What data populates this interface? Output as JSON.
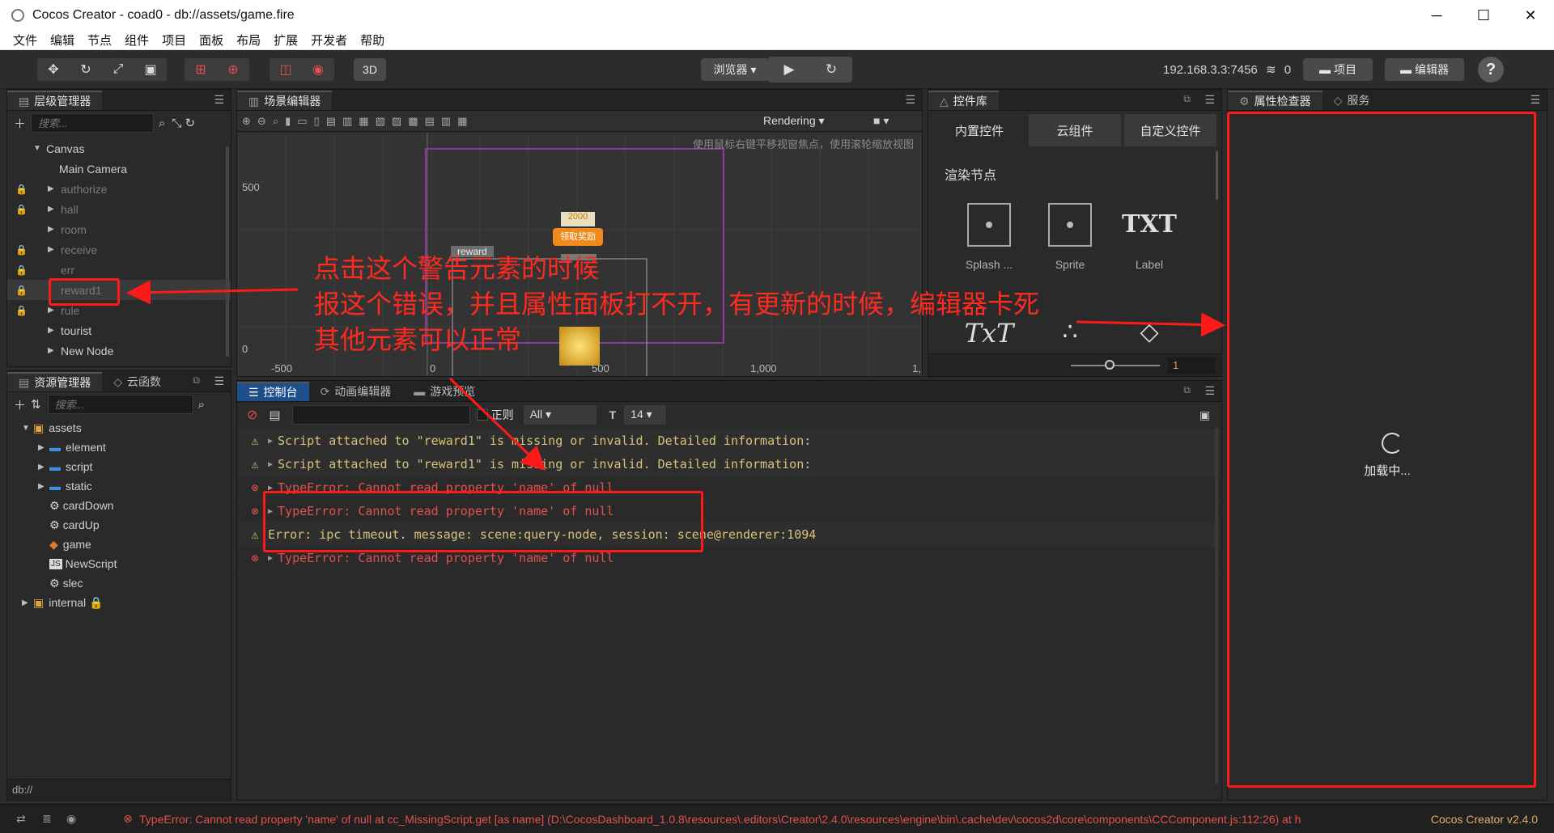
{
  "window": {
    "title": "Cocos Creator - coad0 - db://assets/game.fire",
    "minimize": "─",
    "maximize": "☐",
    "close": "✕"
  },
  "menu": [
    "文件",
    "编辑",
    "节点",
    "组件",
    "项目",
    "面板",
    "布局",
    "扩展",
    "开发者",
    "帮助"
  ],
  "toolbar": {
    "transform_icons": [
      "✥",
      "↻",
      "⤢",
      "▣"
    ],
    "pivot_icons": [
      "⊞",
      "⊕"
    ],
    "gizmo_icons": [
      "◫",
      "◉"
    ],
    "mode_3d": "3D",
    "browser_label": "浏览器 ▾",
    "play_icon": "▶",
    "refresh_icon": "↻",
    "ip": "192.168.3.3:7456",
    "wifi_icon": "≋",
    "connections": "0",
    "project_button": "项目",
    "editor_button": "编辑器",
    "help": "?"
  },
  "hierarchy": {
    "title": "层级管理器",
    "search_placeholder": "搜索...",
    "items": [
      {
        "label": "Canvas",
        "arrow": "▼",
        "locked": false,
        "dim": false
      },
      {
        "label": "Main Camera",
        "arrow": "",
        "locked": false,
        "dim": false
      },
      {
        "label": "authorize",
        "arrow": "▶",
        "locked": true,
        "dim": true
      },
      {
        "label": "hall",
        "arrow": "▶",
        "locked": true,
        "dim": true
      },
      {
        "label": "room",
        "arrow": "▶",
        "locked": false,
        "dim": true
      },
      {
        "label": "receive",
        "arrow": "▶",
        "locked": true,
        "dim": true
      },
      {
        "label": "err",
        "arrow": "",
        "locked": true,
        "dim": true
      },
      {
        "label": "reward1",
        "arrow": "",
        "locked": true,
        "dim": true
      },
      {
        "label": "rule",
        "arrow": "▶",
        "locked": true,
        "dim": true
      },
      {
        "label": "tourist",
        "arrow": "▶",
        "locked": false,
        "dim": false
      },
      {
        "label": "New Node",
        "arrow": "▶",
        "locked": false,
        "dim": false
      }
    ]
  },
  "assets": {
    "tab_assets": "资源管理器",
    "tab_cloud": "云函数",
    "search_placeholder": "搜索...",
    "items": [
      {
        "label": "assets",
        "icon": "▣",
        "indent": 0,
        "arrow": "▼"
      },
      {
        "label": "element",
        "icon": "▬",
        "indent": 1,
        "arrow": "▶"
      },
      {
        "label": "script",
        "icon": "▬",
        "indent": 1,
        "arrow": "▶"
      },
      {
        "label": "static",
        "icon": "▬",
        "indent": 1,
        "arrow": "▶"
      },
      {
        "label": "cardDown",
        "icon": "⚙",
        "indent": 1,
        "arrow": ""
      },
      {
        "label": "cardUp",
        "icon": "⚙",
        "indent": 1,
        "arrow": ""
      },
      {
        "label": "game",
        "icon": "◆",
        "indent": 1,
        "arrow": ""
      },
      {
        "label": "NewScript",
        "icon": "JS",
        "indent": 1,
        "arrow": ""
      },
      {
        "label": "slec",
        "icon": "⚙",
        "indent": 1,
        "arrow": ""
      },
      {
        "label": "internal 🔒",
        "icon": "▣",
        "indent": 0,
        "arrow": "▶"
      }
    ],
    "path": "db://"
  },
  "scene": {
    "title": "场景编辑器",
    "rendering": "Rendering",
    "hint": "使用鼠标右键平移视窗焦点，使用滚轮缩放视图",
    "axis_y_500": "500",
    "axis_y_0": "0",
    "axis_x": [
      "-500",
      "0",
      "500",
      "1,000",
      "1,"
    ],
    "reward_label": "reward",
    "gold_text": "2000",
    "button_text": "领取奖励"
  },
  "library": {
    "title": "控件库",
    "tabs": [
      "内置控件",
      "云组件",
      "自定义控件"
    ],
    "section": "渲染节点",
    "items": [
      {
        "label": "Splash ...",
        "kind": "icon"
      },
      {
        "label": "Sprite",
        "kind": "icon"
      },
      {
        "label": "Label",
        "kind": "TXT"
      }
    ],
    "row2": [
      "TxT",
      "∴",
      "◇"
    ],
    "slider_value": "1"
  },
  "inspector": {
    "tab_inspector": "属性检查器",
    "tab_service": "服务",
    "loading": "加载中..."
  },
  "console": {
    "tabs": [
      "控制台",
      "动画编辑器",
      "游戏预览"
    ],
    "regex_label": "正则",
    "filter": "All ▾",
    "font_size": "14 ▾",
    "lines": [
      {
        "level": "warn",
        "text": "Script attached to \"reward1\" is missing or invalid. Detailed information:"
      },
      {
        "level": "warn",
        "text": "Script attached to \"reward1\" is missing or invalid. Detailed information:"
      },
      {
        "level": "err",
        "text": "TypeError: Cannot read property 'name' of null"
      },
      {
        "level": "err",
        "text": "TypeError: Cannot read property 'name' of null"
      },
      {
        "level": "warn-plain",
        "text": "Error: ipc timeout. message: scene:query-node, session: scene@renderer:1094"
      },
      {
        "level": "err",
        "text": "TypeError: Cannot read property 'name' of null"
      }
    ]
  },
  "status": {
    "error": "TypeError: Cannot read property 'name' of null at cc_MissingScript.get [as name] (D:\\CocosDashboard_1.0.8\\resources\\.editors\\Creator\\2.4.0\\resources\\engine\\bin\\.cache\\dev\\cocos2d\\core\\components\\CCComponent.js:112:26) at h",
    "version": "Cocos Creator v2.4.0"
  },
  "annotations": {
    "line1": "点击这个警告元素的时候",
    "line2": "报这个错误，并且属性面板打不开，有更新的时候，编辑器卡死",
    "line3": "其他元素可以正常"
  },
  "colors": {
    "accent_red": "#ff1a1a",
    "warn": "#d9c27a",
    "error": "#e0524f",
    "lock": "#e06a1e"
  }
}
